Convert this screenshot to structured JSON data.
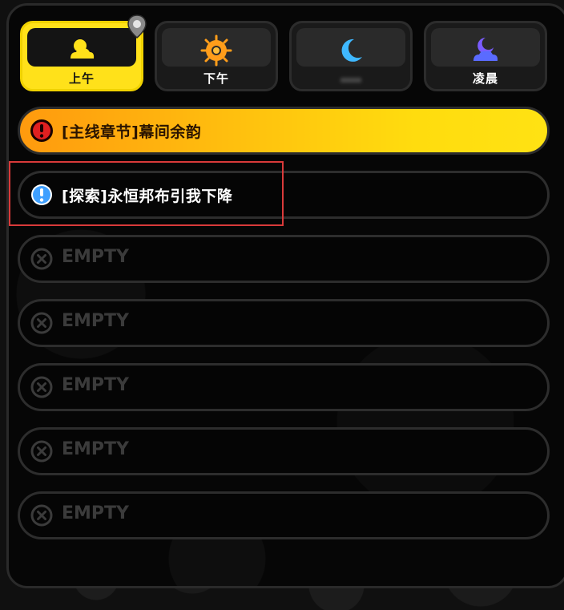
{
  "tabs": [
    {
      "label": "上午",
      "icon": "sun-cloud-icon",
      "active": true
    },
    {
      "label": "下午",
      "icon": "sun-icon",
      "active": false
    },
    {
      "label": "",
      "icon": "crescent-moon-icon",
      "active": false
    },
    {
      "label": "凌晨",
      "icon": "moon-cloud-icon",
      "active": false
    }
  ],
  "quests": [
    {
      "type": "main",
      "icon": "exclamation-red-icon",
      "text": "[主线章节]幕间余韵"
    },
    {
      "type": "explore",
      "icon": "exclamation-blue-icon",
      "text": "[探索]永恒邦布引我下降"
    },
    {
      "type": "empty",
      "icon": "x-circle-icon",
      "text": "EMPTY"
    },
    {
      "type": "empty",
      "icon": "x-circle-icon",
      "text": "EMPTY"
    },
    {
      "type": "empty",
      "icon": "x-circle-icon",
      "text": "EMPTY"
    },
    {
      "type": "empty",
      "icon": "x-circle-icon",
      "text": "EMPTY"
    },
    {
      "type": "empty",
      "icon": "x-circle-icon",
      "text": "EMPTY"
    }
  ],
  "colors": {
    "active_tab": "#ffe11a",
    "main_quest_gradient_start": "#ff9a0e",
    "main_quest_gradient_end": "#ffe213",
    "highlight_box": "#d93a3a",
    "explore_icon": "#3fa0ff",
    "main_icon": "#e02020"
  }
}
